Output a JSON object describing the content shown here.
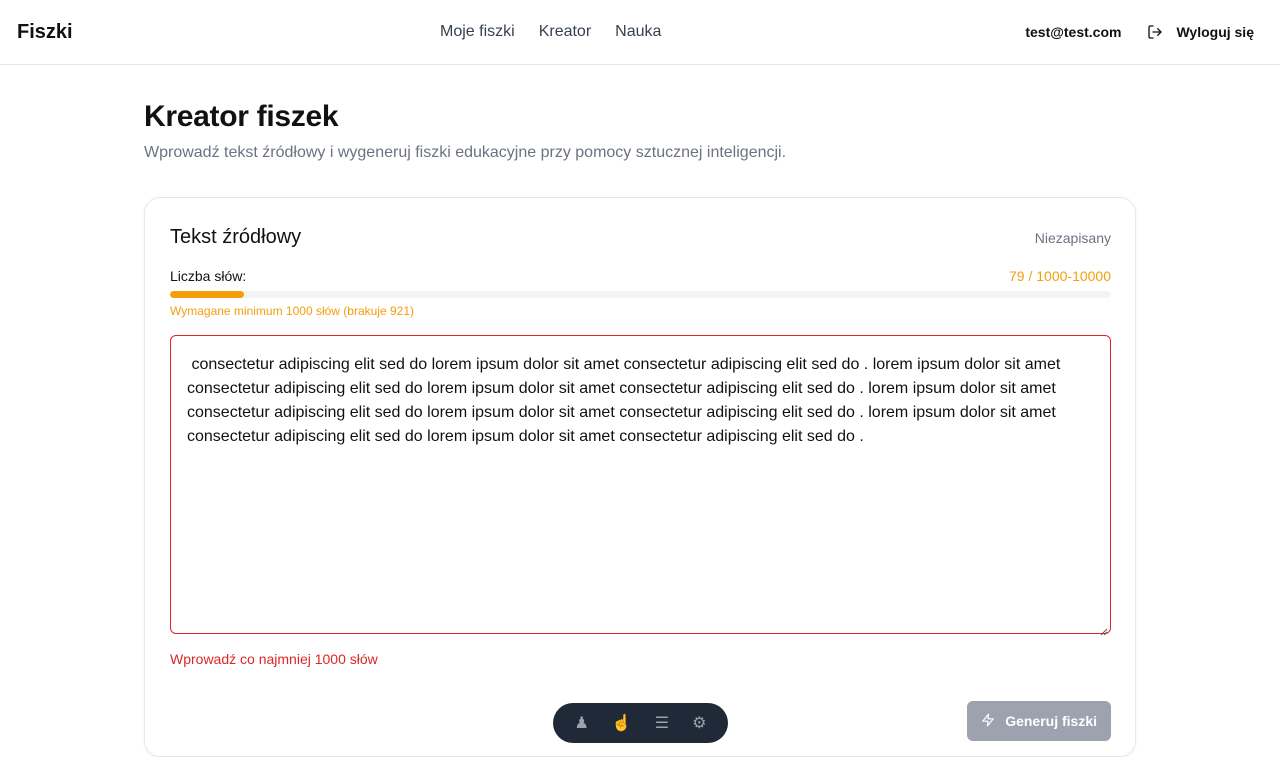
{
  "header": {
    "brand": "Fiszki",
    "nav": [
      {
        "label": "Moje fiszki"
      },
      {
        "label": "Kreator"
      },
      {
        "label": "Nauka"
      }
    ],
    "user_email": "test@test.com",
    "logout_label": "Wyloguj się"
  },
  "page": {
    "title": "Kreator fiszek",
    "subtitle": "Wprowadź tekst źródłowy i wygeneruj fiszki edukacyjne przy pomocy sztucznej inteligencji."
  },
  "card": {
    "title": "Tekst źródłowy",
    "save_status": "Niezapisany",
    "word_count_label": "Liczba słów:",
    "word_count_value": "79 / 1000-10000",
    "progress_fraction": 0.079,
    "word_count_warning": "Wymagane minimum 1000 słów (brakuje 921)",
    "source_text": " consectetur adipiscing elit sed do lorem ipsum dolor sit amet consectetur adipiscing elit sed do . lorem ipsum dolor sit amet consectetur adipiscing elit sed do lorem ipsum dolor sit amet consectetur adipiscing elit sed do . lorem ipsum dolor sit amet consectetur adipiscing elit sed do lorem ipsum dolor sit amet consectetur adipiscing elit sed do . lorem ipsum dolor sit amet consectetur adipiscing elit sed do lorem ipsum dolor sit amet consectetur adipiscing elit sed do .",
    "error": "Wprowadź co najmniej 1000 słów",
    "generate_label": "Generuj fiszki"
  },
  "colors": {
    "accent_warning": "#f59e0b",
    "error": "#dc2626",
    "button_disabled": "#9ca3af"
  }
}
